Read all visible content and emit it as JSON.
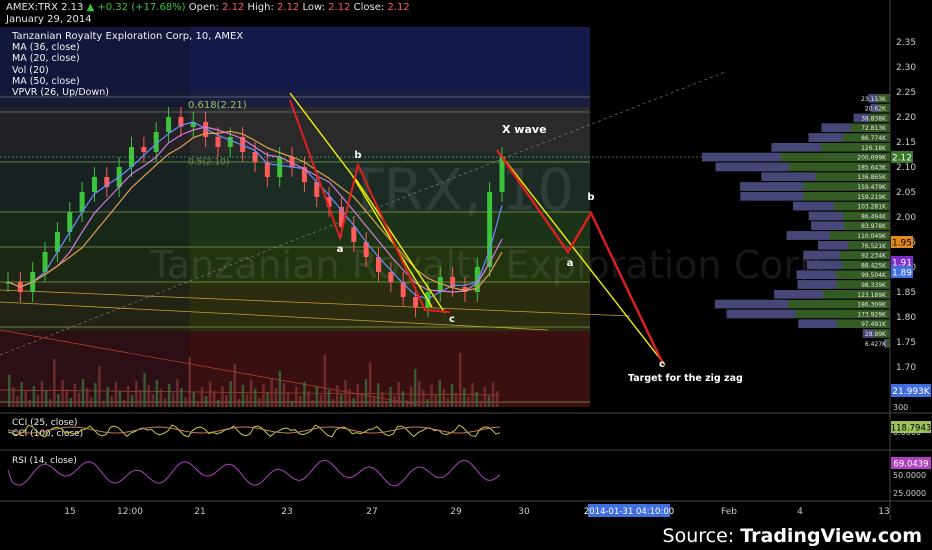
{
  "header": {
    "symbol": "AMEX:TRX",
    "price": "2.13",
    "change": "▲ +0.32 (+17.68%)",
    "open_label": "Open:",
    "open": "2.12",
    "high_label": "High:",
    "high": "2.12",
    "low_label": "Low:",
    "low": "2.12",
    "close_label": "Close:",
    "close": "2.12",
    "date": "January 29, 2014"
  },
  "legend": {
    "title": "Tanzanian Royalty Exploration Corp, 10, AMEX",
    "items": [
      "MA (36, close)",
      "MA (20, close)",
      "Vol (20)",
      "MA (50, close)",
      "VPVR (26, Up/Down)"
    ]
  },
  "watermark": "Tanzanian Royalty Exploration Corp",
  "watermark_symbol": "TRX, 10",
  "annotations": {
    "x_wave": "X wave",
    "target": "Target for the zig zag",
    "fib_label": "0.618(2.21)",
    "fib_label2": "0.5(2.10)",
    "wave_letters": [
      "a",
      "b",
      "c",
      "a",
      "b",
      "c",
      "b",
      "a",
      "c"
    ]
  },
  "cursor_time": "2014-01-31 04:10:00",
  "price_badges": {
    "current": "2.12",
    "orange": "1.95",
    "purple": "1.91",
    "blue": "1.89",
    "volume": "21.993K",
    "cci": "118.7943",
    "cci_low": "0.0000",
    "rsi": "69.0439"
  },
  "panes": {
    "cci_label": "CCI (25, close)",
    "cci2_label": "CCI (100, close)",
    "rsi_label": "RSI (14, close)"
  },
  "vpvr_labels": [
    "23.153K",
    "20.62K",
    "38.838K",
    "72.813K",
    "86.774K",
    "126.18K",
    "200.099K",
    "185.643K",
    "136.865K",
    "159.479K",
    "159.219K",
    "103.281K",
    "86.494K",
    "83.978K",
    "110.049K",
    "76.521K",
    "92.234K",
    "88.425K",
    "99.504K",
    "98.339K",
    "123.189K",
    "186.309K",
    "173.929K",
    "97.491K",
    "28.99K",
    "6.427K"
  ],
  "colors": {
    "up": "#3cc43c",
    "down": "#ff5b5b",
    "yellow": "#f2f200",
    "red_wave": "#e02020",
    "fib_green": "#1d3d14",
    "fib_red": "#3a0f0f",
    "fib_blue": "#141a4a"
  },
  "footer": {
    "source_prefix": "Source: ",
    "source_brand": "TradingView.com"
  },
  "chart_data": {
    "type": "line",
    "ylim": [
      1.62,
      2.38
    ],
    "y_ticks": [
      "2.35",
      "2.30",
      "2.25",
      "2.20",
      "2.15",
      "2.10",
      "2.05",
      "2.00",
      "1.95",
      "1.90",
      "1.85",
      "1.80",
      "1.75",
      "1.70",
      "1.65"
    ],
    "x_ticks": [
      "15",
      "12:00",
      "21",
      "23",
      "27",
      "29",
      "30",
      "Feb",
      "4",
      "13"
    ],
    "cci_ticks": [
      "300",
      "0.0000"
    ],
    "rsi_ticks": [
      "50.0000",
      "25.0000"
    ],
    "price_path": [
      1.87,
      1.85,
      1.89,
      1.93,
      1.97,
      2.01,
      2.05,
      2.08,
      2.06,
      2.1,
      2.14,
      2.13,
      2.17,
      2.2,
      2.18,
      2.19,
      2.16,
      2.14,
      2.16,
      2.13,
      2.11,
      2.08,
      2.12,
      2.1,
      2.07,
      2.04,
      2.02,
      1.98,
      1.95,
      1.92,
      1.89,
      1.87,
      1.84,
      1.82,
      1.85,
      1.88,
      1.86,
      1.85,
      1.9,
      2.05,
      2.12
    ],
    "wave_projection": [
      {
        "label": "X wave",
        "price": 2.12
      },
      {
        "label": "a",
        "price": 1.94
      },
      {
        "label": "b",
        "price": 2.0
      },
      {
        "label": "c",
        "price": 1.72
      }
    ],
    "fib_levels": [
      2.24,
      2.21,
      2.11,
      2.01,
      1.94,
      1.87,
      1.78,
      1.63
    ],
    "vpvr_volume": [
      23.153,
      20.62,
      38.838,
      72.813,
      86.774,
      126.18,
      200.099,
      185.643,
      136.865,
      159.479,
      159.219,
      103.281,
      86.494,
      83.978,
      110.049,
      76.521,
      92.234,
      88.425,
      99.504,
      98.339,
      123.189,
      186.309,
      173.929,
      97.491,
      28.99,
      6.427
    ]
  }
}
